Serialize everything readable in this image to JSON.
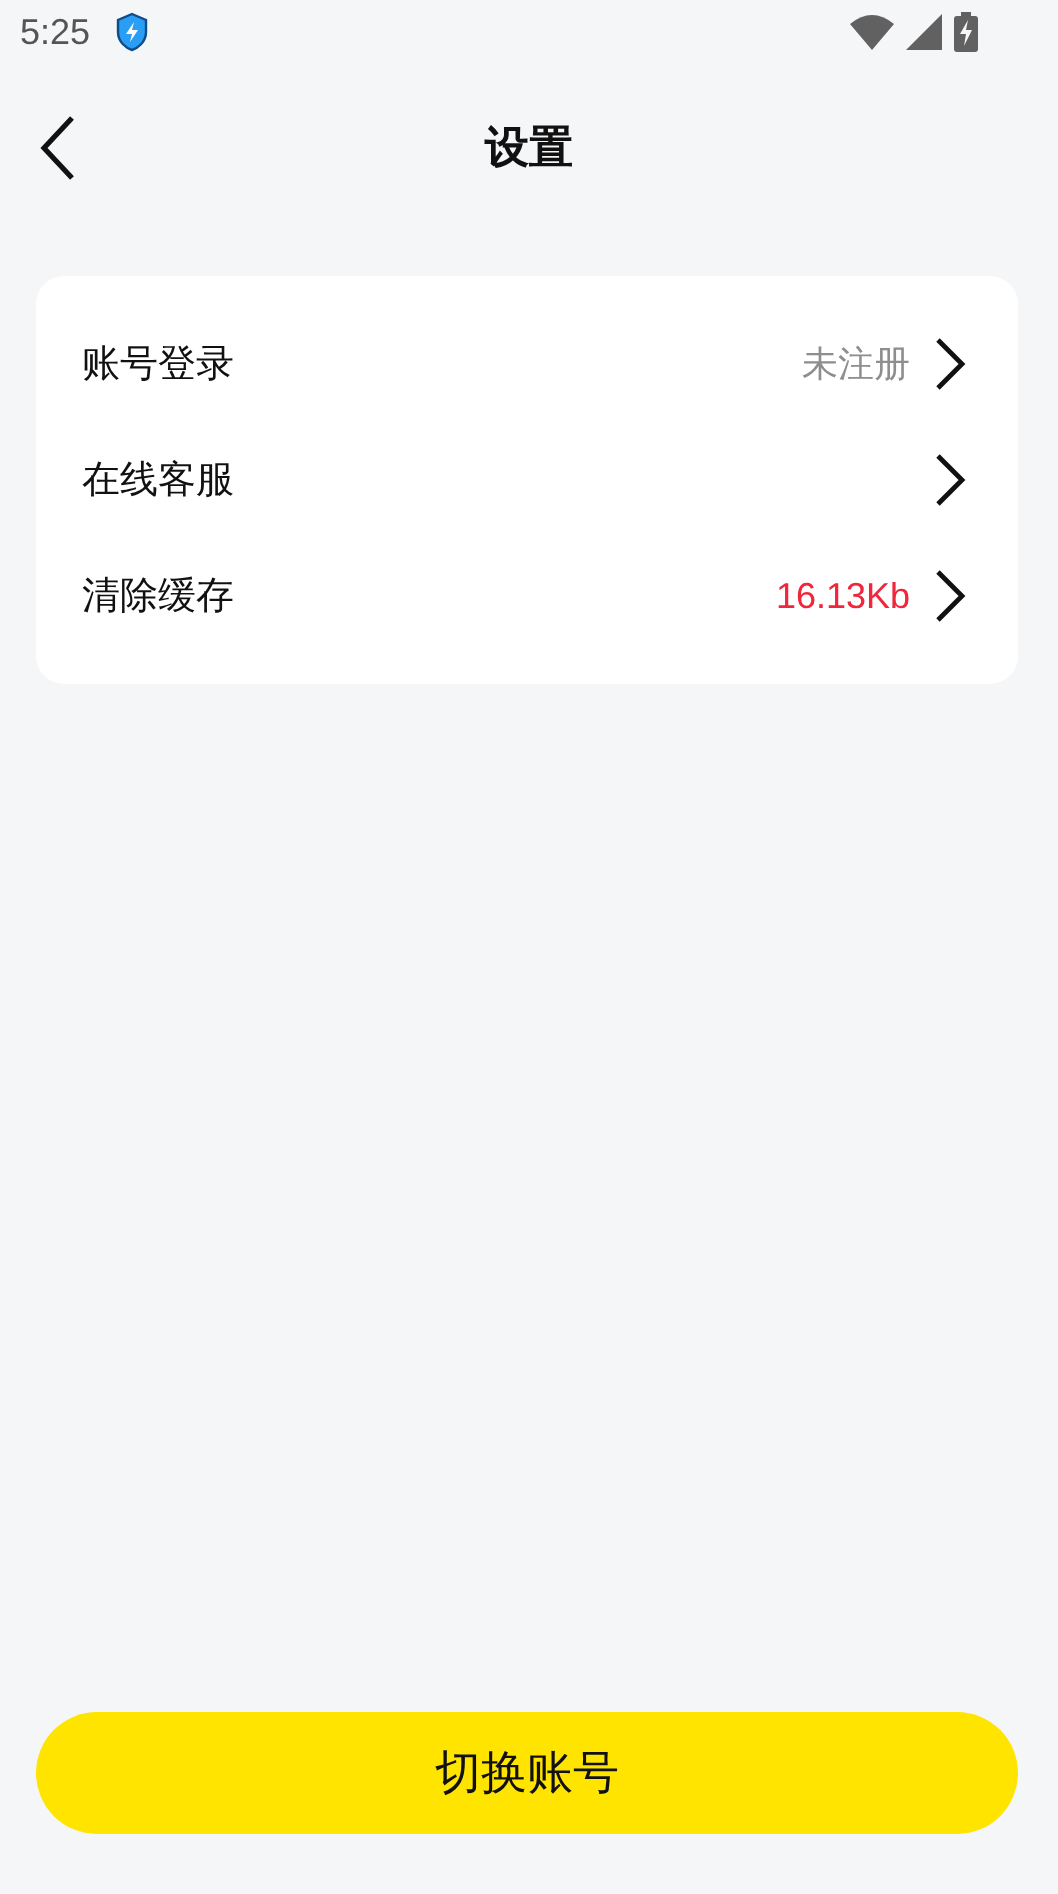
{
  "status_bar": {
    "time": "5:25"
  },
  "header": {
    "title": "设置"
  },
  "settings": [
    {
      "label": "账号登录",
      "value": "未注册",
      "color": "#8e8e8e"
    },
    {
      "label": "在线客服"
    },
    {
      "label": "清除缓存",
      "value": "16.13Kb",
      "color": "#f0263c"
    }
  ],
  "button": {
    "label": "切换账号"
  }
}
